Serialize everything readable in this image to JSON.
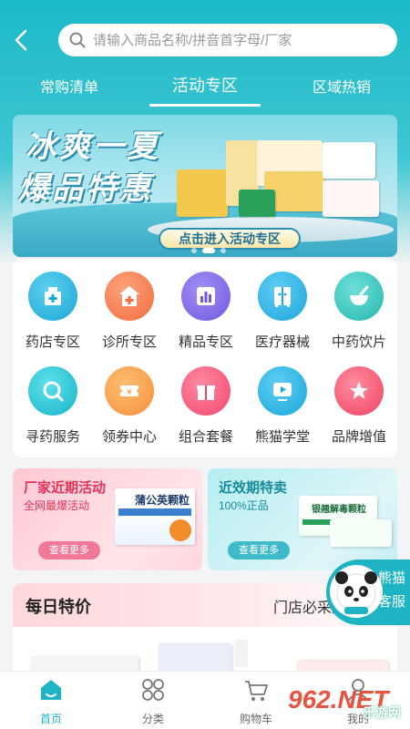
{
  "search": {
    "placeholder": "请输入商品名称/拼音首字母/厂家"
  },
  "tabs": [
    {
      "label": "常购清单"
    },
    {
      "label": "活动专区"
    },
    {
      "label": "区域热销"
    }
  ],
  "banner": {
    "title_line1": "冰爽一夏",
    "title_line2": "爆品特惠",
    "cta": "点击进入活动专区"
  },
  "grid": [
    {
      "label": "药店专区",
      "icon": "pharmacy-icon",
      "color": "#1ba7d4"
    },
    {
      "label": "诊所专区",
      "icon": "clinic-icon",
      "color": "#f06b3d"
    },
    {
      "label": "精品专区",
      "icon": "chart-icon",
      "color": "#7157e0"
    },
    {
      "label": "医疗器械",
      "icon": "cabinet-icon",
      "color": "#1fa7dc"
    },
    {
      "label": "中药饮片",
      "icon": "mortar-icon",
      "color": "#25b7b0"
    },
    {
      "label": "寻药服务",
      "icon": "search-pill-icon",
      "color": "#17b4c9"
    },
    {
      "label": "领券中心",
      "icon": "coupon-icon",
      "color": "#f5903a"
    },
    {
      "label": "组合套餐",
      "icon": "gift-icon",
      "color": "#f2466b"
    },
    {
      "label": "熊猫学堂",
      "icon": "play-icon",
      "color": "#1aa8d8"
    },
    {
      "label": "品牌增值",
      "icon": "star-icon",
      "color": "#ef4460"
    }
  ],
  "promos": [
    {
      "title": "厂家近期活动",
      "subtitle": "全网最爆活动",
      "button": "查看更多",
      "product_name": "蒲公英颗粒"
    },
    {
      "title": "近效期特卖",
      "subtitle": "100%正品",
      "button": "查看更多",
      "product_name": "银翘解毒颗粒"
    }
  ],
  "daily": {
    "title": "每日特价",
    "more": "门店必采爆品"
  },
  "service": {
    "label_line1": "熊猫",
    "label_line2": "客服"
  },
  "bottom_nav": [
    {
      "label": "首页",
      "icon": "home-icon"
    },
    {
      "label": "分类",
      "icon": "category-icon"
    },
    {
      "label": "购物车",
      "icon": "cart-icon"
    },
    {
      "label": "我的",
      "icon": "user-icon"
    }
  ],
  "watermark": {
    "main": "962.NET",
    "sub": "乐游网"
  },
  "colors": {
    "brand": "#1eb4c3",
    "promo_pink": "#e2335a",
    "promo_teal": "#178b9b"
  }
}
